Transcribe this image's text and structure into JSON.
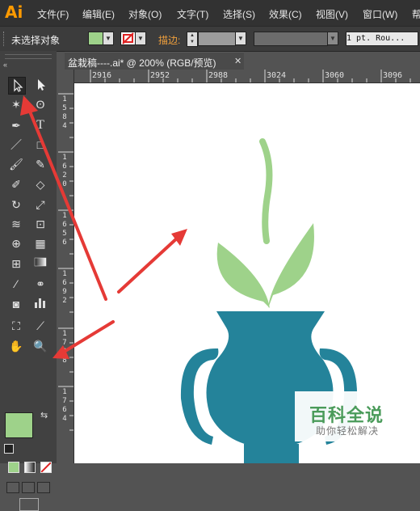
{
  "app": {
    "logo": "Ai"
  },
  "menu": [
    "文件(F)",
    "编辑(E)",
    "对象(O)",
    "文字(T)",
    "选择(S)",
    "效果(C)",
    "视图(V)",
    "窗口(W)",
    "帮"
  ],
  "control_bar": {
    "selection_status": "未选择对象",
    "stroke_label": "描边:",
    "stroke_style_value": "1 pt. Rou...",
    "fill_color": "#9ed28a"
  },
  "document_tab": {
    "title": "盆栽稿----.ai* @ 200% (RGB/预览)",
    "close": "✕"
  },
  "ruler": {
    "horizontal_ticks": [
      "2916",
      "2952",
      "2988",
      "3024",
      "3060",
      "3096"
    ],
    "vertical_ticks": [
      "1 5 8 4",
      "1 6 2 0",
      "1 6 5 6",
      "1 6 9 2",
      "1 7 2 8",
      "1 7 6 4"
    ]
  },
  "toolbar": {
    "tools": [
      "selection-tool",
      "direct-selection-tool",
      "magic-wand-tool",
      "lasso-tool",
      "pen-tool",
      "type-tool",
      "line-segment-tool",
      "rectangle-tool",
      "paintbrush-tool",
      "pencil-tool",
      "blob-brush-tool",
      "eraser-tool",
      "rotate-tool",
      "scale-tool",
      "width-tool",
      "free-transform-tool",
      "shape-builder-tool",
      "perspective-grid-tool",
      "mesh-tool",
      "gradient-tool",
      "eyedropper-tool",
      "blend-tool",
      "symbol-sprayer-tool",
      "column-graph-tool",
      "artboard-tool",
      "slice-tool",
      "hand-tool",
      "zoom-tool"
    ],
    "fill_color": "#9ed28a",
    "stroke_color": "#ffffff"
  },
  "artwork": {
    "vase_color": "#24839a",
    "leaf_color": "#9ed28a",
    "arrow_color": "#e53a36"
  },
  "watermark": {
    "title": "百科全说",
    "subtitle": "助你轻松解决"
  }
}
